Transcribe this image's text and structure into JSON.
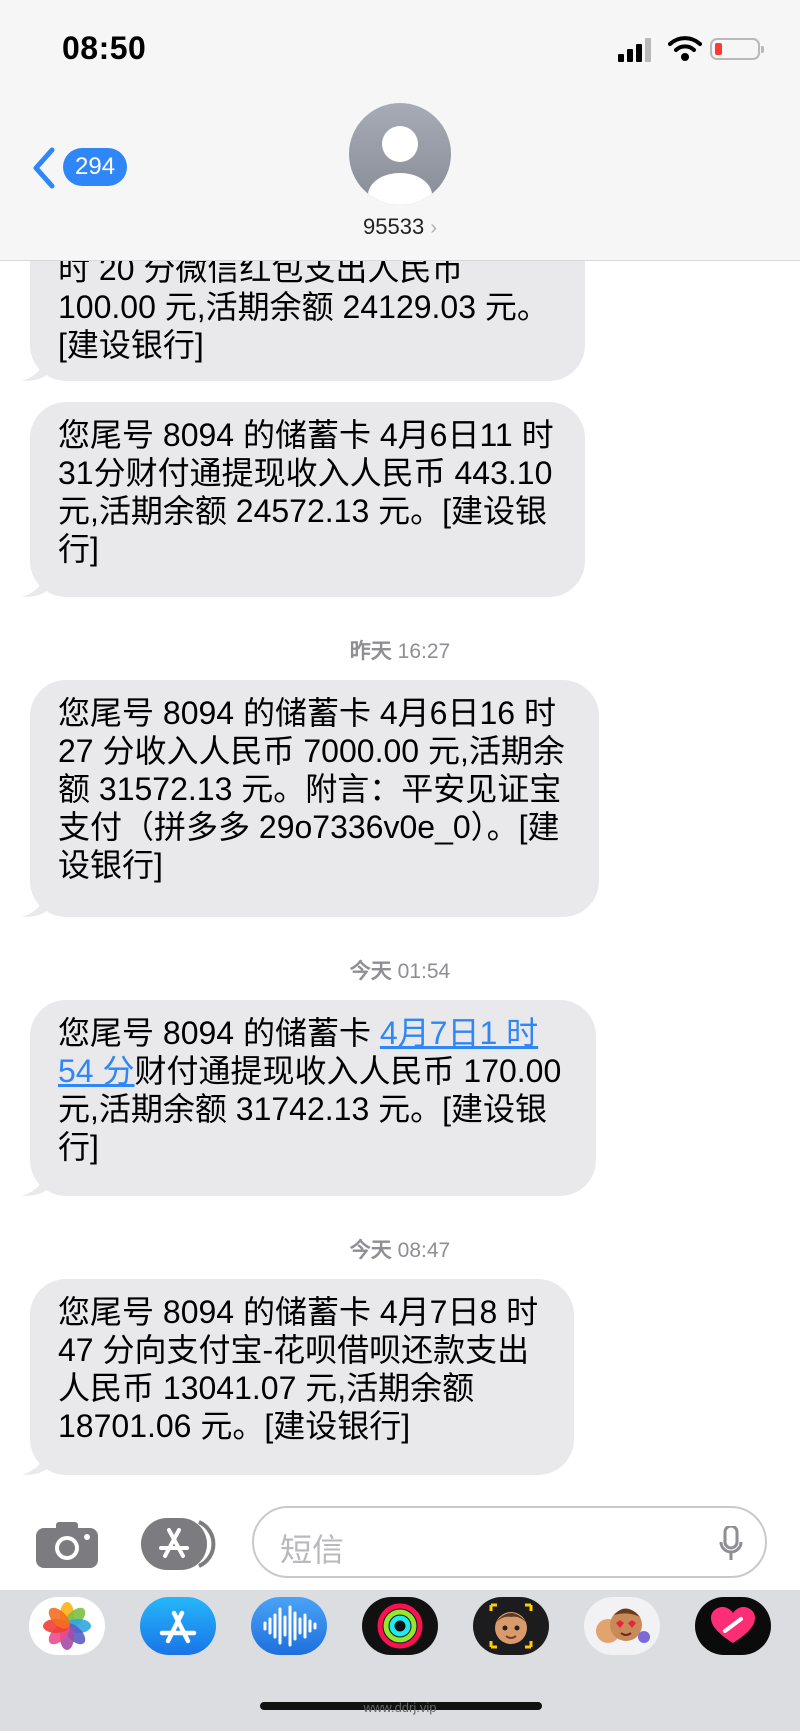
{
  "status": {
    "time": "08:50"
  },
  "header": {
    "back_badge": "294",
    "contact": "95533",
    "contact_arrow": "›"
  },
  "messages": [
    {
      "text": "时 20 分微信红包支出人民币 100.00 元,活期余额 24129.03 元。[建设银行]"
    },
    {
      "text": "您尾号 8094 的储蓄卡 4月6日11 时 31分财付通提现收入人民币 443.10 元,活期余额 24572.13 元。[建设银行]"
    },
    {
      "timestamp_day": "昨天",
      "timestamp_time": "16:27",
      "text": "您尾号 8094 的储蓄卡 4月6日16 时 27 分收入人民币 7000.00 元,活期余额 31572.13 元。附言：平安见证宝支付（拼多多 29o7336v0e_0）。[建设银行]"
    },
    {
      "timestamp_day": "今天",
      "timestamp_time": "01:54",
      "text_before": "您尾号 8094 的储蓄卡 ",
      "link": "4月7日1 时 54 分",
      "text_after": "财付通提现收入人民币 170.00 元,活期余额 31742.13 元。[建设银行]"
    },
    {
      "timestamp_day": "今天",
      "timestamp_time": "08:47",
      "text": "您尾号 8094 的储蓄卡 4月7日8 时 47 分向支付宝-花呗借呗还款支出人民币 13041.07 元,活期余额 18701.06 元。[建设银行]"
    }
  ],
  "composer": {
    "placeholder": "短信"
  },
  "apps": [
    "photos-icon",
    "app-store-icon",
    "audio-message-icon",
    "activity-icon",
    "memoji-icon",
    "animoji-stickers-icon",
    "digital-touch-icon"
  ],
  "colors": {
    "accent": "#2f86f6",
    "bubble": "#e9e9eb",
    "battery_low": "#ff3b30"
  },
  "watermark": "www.ddrj.vip"
}
